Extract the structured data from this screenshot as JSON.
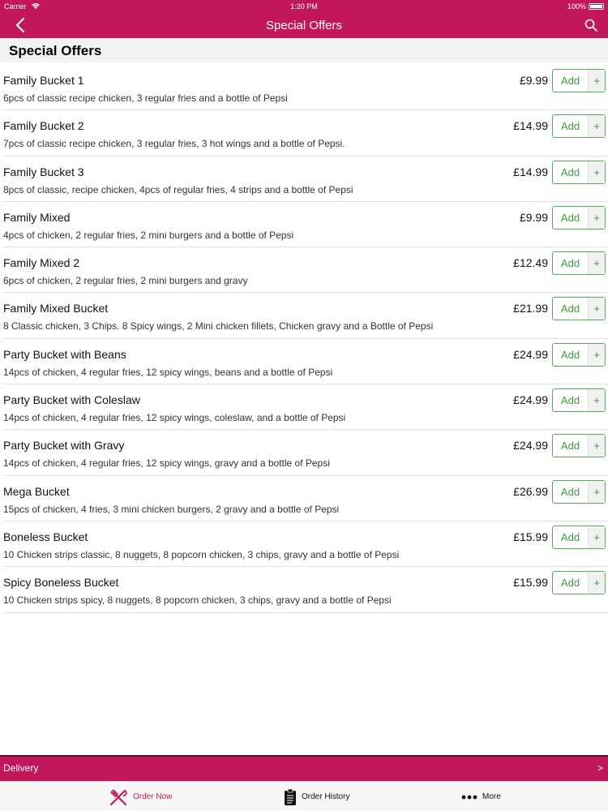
{
  "status_bar": {
    "carrier": "Carrier",
    "time": "1:20 PM",
    "battery": "100%"
  },
  "nav": {
    "title": "Special Offers",
    "back_icon": "chevron-left-icon",
    "search_icon": "search-icon"
  },
  "section": {
    "title": "Special Offers"
  },
  "add_button": {
    "label": "Add",
    "plus": "+"
  },
  "items": [
    {
      "name": "Family Bucket 1",
      "description": "6pcs of classic recipe chicken, 3 regular fries and a bottle of Pepsi",
      "price": "£9.99"
    },
    {
      "name": "Family Bucket 2",
      "description": "7pcs of classic recipe chicken, 3 regular fries, 3 hot wings and a bottle of Pepsi.",
      "price": "£14.99"
    },
    {
      "name": "Family Bucket 3",
      "description": "8pcs of classic, recipe chicken, 4pcs of regular fries, 4 strips and a bottle of Pepsi",
      "price": "£14.99"
    },
    {
      "name": "Family Mixed",
      "description": "4pcs of chicken, 2 regular fries, 2 mini burgers and a bottle of Pepsi",
      "price": "£9.99"
    },
    {
      "name": "Family Mixed 2",
      "description": "6pcs of chicken, 2 regular fries, 2 mini burgers and gravy",
      "price": "£12.49"
    },
    {
      "name": "Family Mixed Bucket",
      "description": "8 Classic chicken, 3 Chips. 8 Spicy wings, 2 Mini chicken fillets, Chicken gravy and a Bottle of Pepsi",
      "price": "£21.99"
    },
    {
      "name": "Party Bucket with Beans",
      "description": "14pcs of chicken, 4 regular fries, 12 spicy wings, beans and a bottle of Pepsi",
      "price": "£24.99"
    },
    {
      "name": "Party Bucket with Coleslaw",
      "description": "14pcs of chicken, 4 regular fries, 12 spicy wings, coleslaw, and a bottle of Pepsi",
      "price": "£24.99"
    },
    {
      "name": "Party Bucket with Gravy",
      "description": "14pcs of chicken, 4 regular fries, 12 spicy wings, gravy and a bottle of Pepsi",
      "price": "£24.99"
    },
    {
      "name": "Mega Bucket",
      "description": "15pcs of chicken, 4 fries, 3 mini chicken burgers, 2 gravy and a bottle of Pepsi",
      "price": "£26.99"
    },
    {
      "name": "Boneless Bucket",
      "description": "10 Chicken strips classic, 8 nuggets, 8 popcorn chicken, 3 chips, gravy and a bottle of Pepsi",
      "price": "£15.99"
    },
    {
      "name": "Spicy Boneless Bucket",
      "description": "10 Chicken strips spicy, 8 nuggets, 8 popcorn chicken, 3 chips, gravy and a  bottle of Pepsi",
      "price": "£15.99"
    }
  ],
  "delivery_bar": {
    "label": "Delivery",
    "chevron": ">"
  },
  "tabs": [
    {
      "label": "Order Now",
      "icon": "fork-knife-icon",
      "active": true
    },
    {
      "label": "Order History",
      "icon": "clipboard-icon",
      "active": false
    },
    {
      "label": "More",
      "icon": "more-dots-icon",
      "active": false
    }
  ],
  "colors": {
    "brand": "#c2185b",
    "add_green": "#3d9a40"
  }
}
